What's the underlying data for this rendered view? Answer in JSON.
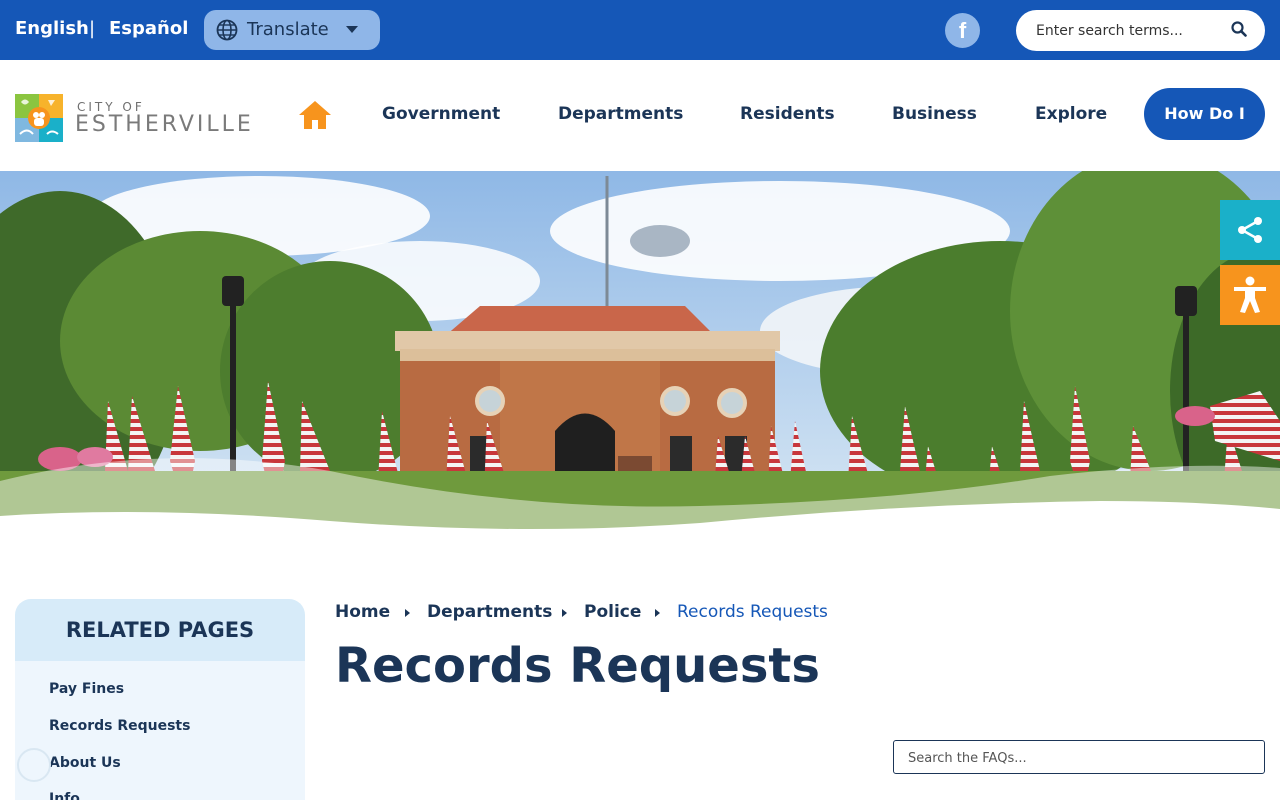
{
  "topbar": {
    "languages": [
      "English",
      "Español"
    ],
    "separator": "|",
    "translate_label": "Translate",
    "search_placeholder": "Enter search terms..."
  },
  "logo": {
    "line1": "CITY OF",
    "line2": "ESTHERVILLE"
  },
  "nav": {
    "items": [
      "Government",
      "Departments",
      "Residents",
      "Business",
      "Explore"
    ],
    "cta": "How Do I"
  },
  "breadcrumb": [
    "Home",
    "Departments",
    "Police",
    "Records Requests"
  ],
  "page_title": "Records Requests",
  "sidebar": {
    "heading": "RELATED PAGES",
    "links": [
      "Pay Fines",
      "Records Requests",
      "About Us",
      "Info"
    ]
  },
  "faq_search_placeholder": "Search the FAQs...",
  "icons": {
    "home": "home-icon",
    "globe": "globe-icon",
    "facebook": "facebook-icon",
    "search": "search-icon",
    "share": "share-icon",
    "accessibility": "accessibility-icon"
  },
  "colors": {
    "primary_blue": "#1557b7",
    "dark_navy": "#1b3557",
    "accent_orange": "#f7941d",
    "share_teal": "#1ab0c9",
    "sidebar_bg": "#d7ebf9"
  }
}
